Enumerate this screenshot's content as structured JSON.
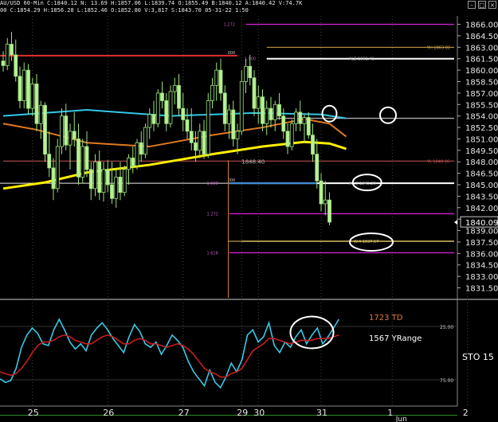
{
  "header": {
    "line1": "AU/USD 60-Min  C:1840.12  N:  13.69  H:1857.06  L:1839.74  O:1855.49  B:1840.12  A:1840.42  V:74.7K",
    "line2": "00  C:1854.29  H:1856.28  L:1852.46  O:1852.80  V:3,817  S:1843.70  05-31-22  1:50"
  },
  "chart_data": [
    {
      "type": "candlestick",
      "title": "",
      "y_axis": {
        "side": "right",
        "ticks": [
          1866.0,
          1864.5,
          1863.0,
          1861.5,
          1860.0,
          1858.5,
          1857.0,
          1855.5,
          1854.0,
          1852.5,
          1851.0,
          1849.5,
          1848.0,
          1846.5,
          1845.0,
          1843.5,
          1842.0,
          1840.5,
          1839.0,
          1837.5,
          1836.0,
          1834.5,
          1833.0,
          1831.5
        ],
        "range": [
          1830.2,
          1867.1
        ]
      },
      "x_axis": {
        "tick_labels": [
          {
            "label": "25",
            "bar": 7
          },
          {
            "label": "26",
            "bar": 25
          },
          {
            "label": "27",
            "bar": 43
          },
          {
            "label": "29",
            "bar": 57
          },
          {
            "label": "30",
            "bar": 61
          },
          {
            "label": "31",
            "bar": 76
          },
          {
            "label": "1",
            "bar": 93
          },
          {
            "label": "2",
            "bar": 111
          },
          {
            "label": "Jun",
            "bar": 95
          }
        ]
      },
      "last_price_label": "1840.09",
      "last_price": 1840.09,
      "candles": [
        {
          "o": 1861.2,
          "h": 1862.5,
          "l": 1859.8,
          "c": 1860.6
        },
        {
          "o": 1860.6,
          "h": 1864.2,
          "l": 1860.0,
          "c": 1863.4
        },
        {
          "o": 1863.4,
          "h": 1865.0,
          "l": 1861.2,
          "c": 1862.0
        },
        {
          "o": 1862.0,
          "h": 1864.0,
          "l": 1858.5,
          "c": 1859.2
        },
        {
          "o": 1859.2,
          "h": 1860.5,
          "l": 1855.0,
          "c": 1856.0
        },
        {
          "o": 1856.0,
          "h": 1861.0,
          "l": 1855.0,
          "c": 1860.0
        },
        {
          "o": 1860.0,
          "h": 1860.8,
          "l": 1854.2,
          "c": 1855.0
        },
        {
          "o": 1855.0,
          "h": 1859.0,
          "l": 1854.0,
          "c": 1858.2
        },
        {
          "o": 1858.2,
          "h": 1859.5,
          "l": 1852.0,
          "c": 1853.0
        },
        {
          "o": 1853.0,
          "h": 1856.0,
          "l": 1851.0,
          "c": 1855.4
        },
        {
          "o": 1855.4,
          "h": 1855.8,
          "l": 1848.0,
          "c": 1849.0
        },
        {
          "o": 1849.0,
          "h": 1852.0,
          "l": 1846.0,
          "c": 1847.2
        },
        {
          "o": 1847.2,
          "h": 1848.5,
          "l": 1843.0,
          "c": 1844.5
        },
        {
          "o": 1844.5,
          "h": 1851.0,
          "l": 1844.0,
          "c": 1850.0
        },
        {
          "o": 1850.0,
          "h": 1855.0,
          "l": 1849.0,
          "c": 1854.0
        },
        {
          "o": 1854.0,
          "h": 1855.6,
          "l": 1849.5,
          "c": 1850.2
        },
        {
          "o": 1850.2,
          "h": 1853.0,
          "l": 1847.0,
          "c": 1852.0
        },
        {
          "o": 1852.0,
          "h": 1854.5,
          "l": 1850.0,
          "c": 1851.0
        },
        {
          "o": 1851.0,
          "h": 1853.0,
          "l": 1845.0,
          "c": 1846.0
        },
        {
          "o": 1846.0,
          "h": 1851.0,
          "l": 1845.2,
          "c": 1850.0
        },
        {
          "o": 1850.0,
          "h": 1852.0,
          "l": 1846.0,
          "c": 1847.0
        },
        {
          "o": 1847.0,
          "h": 1848.0,
          "l": 1843.0,
          "c": 1844.5
        },
        {
          "o": 1844.5,
          "h": 1849.0,
          "l": 1843.5,
          "c": 1848.0
        },
        {
          "o": 1848.0,
          "h": 1849.5,
          "l": 1843.0,
          "c": 1844.0
        },
        {
          "o": 1844.0,
          "h": 1848.0,
          "l": 1842.8,
          "c": 1847.0
        },
        {
          "o": 1847.0,
          "h": 1848.2,
          "l": 1844.0,
          "c": 1845.0
        },
        {
          "o": 1845.0,
          "h": 1848.0,
          "l": 1842.5,
          "c": 1843.2
        },
        {
          "o": 1843.2,
          "h": 1847.0,
          "l": 1842.0,
          "c": 1846.0
        },
        {
          "o": 1846.0,
          "h": 1848.0,
          "l": 1843.0,
          "c": 1844.0
        },
        {
          "o": 1844.0,
          "h": 1847.5,
          "l": 1843.5,
          "c": 1847.0
        },
        {
          "o": 1847.0,
          "h": 1849.0,
          "l": 1845.0,
          "c": 1848.5
        },
        {
          "o": 1848.5,
          "h": 1850.0,
          "l": 1846.5,
          "c": 1847.5
        },
        {
          "o": 1847.5,
          "h": 1851.0,
          "l": 1847.0,
          "c": 1850.5
        },
        {
          "o": 1850.5,
          "h": 1852.0,
          "l": 1848.0,
          "c": 1849.0
        },
        {
          "o": 1849.0,
          "h": 1853.0,
          "l": 1848.5,
          "c": 1852.5
        },
        {
          "o": 1852.5,
          "h": 1855.0,
          "l": 1851.0,
          "c": 1854.2
        },
        {
          "o": 1854.2,
          "h": 1856.0,
          "l": 1852.0,
          "c": 1853.0
        },
        {
          "o": 1853.0,
          "h": 1857.5,
          "l": 1852.5,
          "c": 1857.0
        },
        {
          "o": 1857.0,
          "h": 1858.5,
          "l": 1855.0,
          "c": 1856.0
        },
        {
          "o": 1856.0,
          "h": 1857.0,
          "l": 1852.0,
          "c": 1853.0
        },
        {
          "o": 1853.0,
          "h": 1858.0,
          "l": 1852.5,
          "c": 1857.2
        },
        {
          "o": 1857.2,
          "h": 1859.0,
          "l": 1855.5,
          "c": 1858.0
        },
        {
          "o": 1858.0,
          "h": 1859.5,
          "l": 1854.0,
          "c": 1855.0
        },
        {
          "o": 1855.0,
          "h": 1857.0,
          "l": 1852.0,
          "c": 1853.5
        },
        {
          "o": 1853.5,
          "h": 1855.0,
          "l": 1851.0,
          "c": 1852.0
        },
        {
          "o": 1852.0,
          "h": 1855.0,
          "l": 1849.5,
          "c": 1850.5
        },
        {
          "o": 1850.5,
          "h": 1852.0,
          "l": 1848.0,
          "c": 1849.5
        },
        {
          "o": 1849.5,
          "h": 1853.0,
          "l": 1848.5,
          "c": 1852.0
        },
        {
          "o": 1852.0,
          "h": 1853.5,
          "l": 1848.4,
          "c": 1849.0
        },
        {
          "o": 1849.0,
          "h": 1857.0,
          "l": 1848.5,
          "c": 1856.0
        },
        {
          "o": 1856.0,
          "h": 1859.0,
          "l": 1855.0,
          "c": 1858.0
        },
        {
          "o": 1858.0,
          "h": 1861.0,
          "l": 1856.0,
          "c": 1860.0
        },
        {
          "o": 1860.0,
          "h": 1861.5,
          "l": 1856.0,
          "c": 1857.0
        },
        {
          "o": 1857.0,
          "h": 1858.0,
          "l": 1852.0,
          "c": 1853.0
        },
        {
          "o": 1853.0,
          "h": 1855.5,
          "l": 1851.0,
          "c": 1854.8
        },
        {
          "o": 1854.8,
          "h": 1856.0,
          "l": 1850.0,
          "c": 1851.0
        },
        {
          "o": 1851.0,
          "h": 1853.0,
          "l": 1849.0,
          "c": 1852.0
        },
        {
          "o": 1852.0,
          "h": 1860.0,
          "l": 1851.5,
          "c": 1858.5
        },
        {
          "o": 1858.5,
          "h": 1861.5,
          "l": 1857.0,
          "c": 1860.5
        },
        {
          "o": 1860.5,
          "h": 1862.0,
          "l": 1858.0,
          "c": 1859.0
        },
        {
          "o": 1859.0,
          "h": 1860.0,
          "l": 1854.0,
          "c": 1855.0
        },
        {
          "o": 1855.0,
          "h": 1858.0,
          "l": 1853.0,
          "c": 1856.5
        },
        {
          "o": 1856.5,
          "h": 1857.5,
          "l": 1852.0,
          "c": 1853.0
        },
        {
          "o": 1853.0,
          "h": 1856.0,
          "l": 1851.5,
          "c": 1855.0
        },
        {
          "o": 1855.0,
          "h": 1856.5,
          "l": 1852.5,
          "c": 1853.5
        },
        {
          "o": 1853.5,
          "h": 1856.0,
          "l": 1852.0,
          "c": 1855.5
        },
        {
          "o": 1855.5,
          "h": 1857.0,
          "l": 1853.5,
          "c": 1854.0
        },
        {
          "o": 1854.0,
          "h": 1855.0,
          "l": 1851.0,
          "c": 1852.0
        },
        {
          "o": 1852.0,
          "h": 1853.0,
          "l": 1849.0,
          "c": 1850.0
        },
        {
          "o": 1850.0,
          "h": 1853.5,
          "l": 1849.5,
          "c": 1853.0
        },
        {
          "o": 1853.0,
          "h": 1855.0,
          "l": 1852.0,
          "c": 1854.5
        },
        {
          "o": 1854.5,
          "h": 1856.0,
          "l": 1852.0,
          "c": 1853.0
        },
        {
          "o": 1853.0,
          "h": 1854.2,
          "l": 1850.5,
          "c": 1853.8
        },
        {
          "o": 1853.8,
          "h": 1854.5,
          "l": 1851.0,
          "c": 1851.5
        },
        {
          "o": 1851.5,
          "h": 1853.0,
          "l": 1848.0,
          "c": 1849.0
        },
        {
          "o": 1849.0,
          "h": 1851.0,
          "l": 1844.5,
          "c": 1845.5
        },
        {
          "o": 1845.5,
          "h": 1846.5,
          "l": 1841.5,
          "c": 1842.5
        },
        {
          "o": 1842.5,
          "h": 1845.5,
          "l": 1841.0,
          "c": 1843.0
        },
        {
          "o": 1843.0,
          "h": 1844.0,
          "l": 1839.7,
          "c": 1840.1
        }
      ],
      "moving_averages": [
        {
          "color": "#33c7e6",
          "values": [
            {
              "bar": 0,
              "v": 1854.0
            },
            {
              "bar": 20,
              "v": 1854.8
            },
            {
              "bar": 40,
              "v": 1854.0
            },
            {
              "bar": 60,
              "v": 1854.4
            },
            {
              "bar": 76,
              "v": 1854.2
            },
            {
              "bar": 82,
              "v": 1853.7
            }
          ]
        },
        {
          "color": "#e07a20",
          "values": [
            {
              "bar": 0,
              "v": 1853.0
            },
            {
              "bar": 8,
              "v": 1852.2
            },
            {
              "bar": 20,
              "v": 1850.5
            },
            {
              "bar": 35,
              "v": 1850.0
            },
            {
              "bar": 50,
              "v": 1851.5
            },
            {
              "bar": 62,
              "v": 1852.5
            },
            {
              "bar": 72,
              "v": 1853.6
            },
            {
              "bar": 78,
              "v": 1853.0
            },
            {
              "bar": 82,
              "v": 1851.3
            }
          ]
        },
        {
          "color": "#ffee00",
          "values": [
            {
              "bar": 0,
              "v": 1844.5
            },
            {
              "bar": 10,
              "v": 1845.3
            },
            {
              "bar": 20,
              "v": 1846.6
            },
            {
              "bar": 35,
              "v": 1847.6
            },
            {
              "bar": 50,
              "v": 1849.0
            },
            {
              "bar": 62,
              "v": 1850.0
            },
            {
              "bar": 72,
              "v": 1850.6
            },
            {
              "bar": 78,
              "v": 1850.4
            },
            {
              "bar": 82,
              "v": 1849.7
            }
          ]
        }
      ],
      "hlines": [
        {
          "v": 1866.0,
          "from_bar": 58,
          "color": "#cc22cc",
          "label": "1.272",
          "label_pos": "left"
        },
        {
          "v": 1861.5,
          "from_bar": 63,
          "color": "#ffffff",
          "label": "1.000",
          "label_pos": "left",
          "tag": "AL5 1861.42"
        },
        {
          "v": 1863.0,
          "from_bar": 63,
          "color": "#d4a850",
          "label": "YH 1863.82",
          "label_pos": "right",
          "thin": true
        },
        {
          "v": 1845.2,
          "from_bar": 54,
          "color": "#ffffff",
          "label": "1.000",
          "label_pos": "left",
          "tag": "A1.2 1845.20"
        },
        {
          "v": 1848.1,
          "from_bar": 0,
          "color": "#cc5555",
          "label": "YL 1848.16",
          "label_pos": "right",
          "thin": true
        },
        {
          "v": 1841.2,
          "from_bar": 54,
          "color": "#cc22cc",
          "label": "1.272",
          "label_pos": "left"
        },
        {
          "v": 1836.1,
          "from_bar": 54,
          "color": "#cc22cc",
          "label": "1.618",
          "label_pos": "left"
        },
        {
          "v": 1837.6,
          "from_bar": 57,
          "color": "#d8c060",
          "label": "W.4 1837.57",
          "label_pos": "right"
        },
        {
          "v": 1853.7,
          "from_bar": 64,
          "color": "#aaaaaa",
          "label": "",
          "label_pos": "none"
        }
      ],
      "left_lines": [
        {
          "v": 1861.9,
          "to_bar": 56,
          "color": "#e03030",
          "label": ".000"
        },
        {
          "v": 1845.2,
          "to_bar": 56,
          "color": "#eeeeee",
          "label": ".000"
        }
      ],
      "swing_label": "1848.40",
      "circles": [
        {
          "bar": 78,
          "v": 1854.3,
          "rx": 9,
          "ry": 10
        },
        {
          "bar": 92,
          "v": 1854.1,
          "rx": 10,
          "ry": 10
        },
        {
          "bar": 87,
          "v": 1845.3,
          "rx": 18,
          "ry": 10
        },
        {
          "bar": 88,
          "v": 1837.5,
          "rx": 27,
          "ry": 11
        }
      ]
    },
    {
      "type": "line",
      "title": "STO 15",
      "labels": [
        {
          "text": "1723 TD",
          "color": "#e07a30"
        },
        {
          "text": "1567 YRange",
          "color": "#ffffff"
        }
      ],
      "y_ticks": [
        25.0,
        75.0
      ],
      "ylim": [
        0,
        100
      ],
      "series": [
        {
          "color": "#3ac8e6",
          "values": [
            22,
            18,
            20,
            34,
            58,
            72,
            80,
            74,
            62,
            60,
            78,
            90,
            78,
            64,
            56,
            62,
            54,
            72,
            80,
            86,
            78,
            68,
            60,
            52,
            70,
            84,
            76,
            62,
            58,
            64,
            50,
            60,
            72,
            66,
            58,
            42,
            30,
            22,
            14,
            32,
            18,
            12,
            24,
            40,
            30,
            44,
            72,
            78,
            64,
            70,
            86,
            60,
            52,
            64,
            58,
            70,
            78,
            62,
            72,
            80,
            62,
            70,
            80,
            90
          ]
        },
        {
          "color": "#c81e1e",
          "values": [
            30,
            28,
            26,
            28,
            34,
            42,
            52,
            60,
            64,
            64,
            66,
            70,
            72,
            70,
            66,
            64,
            62,
            62,
            66,
            70,
            72,
            70,
            66,
            62,
            62,
            66,
            68,
            66,
            62,
            62,
            60,
            58,
            60,
            62,
            60,
            56,
            50,
            42,
            34,
            30,
            28,
            24,
            24,
            28,
            30,
            34,
            44,
            54,
            58,
            62,
            68,
            68,
            66,
            64,
            62,
            64,
            66,
            66,
            66,
            68,
            68,
            68,
            70,
            72
          ]
        }
      ],
      "circle": {
        "index": 58,
        "v": 75
      }
    }
  ]
}
